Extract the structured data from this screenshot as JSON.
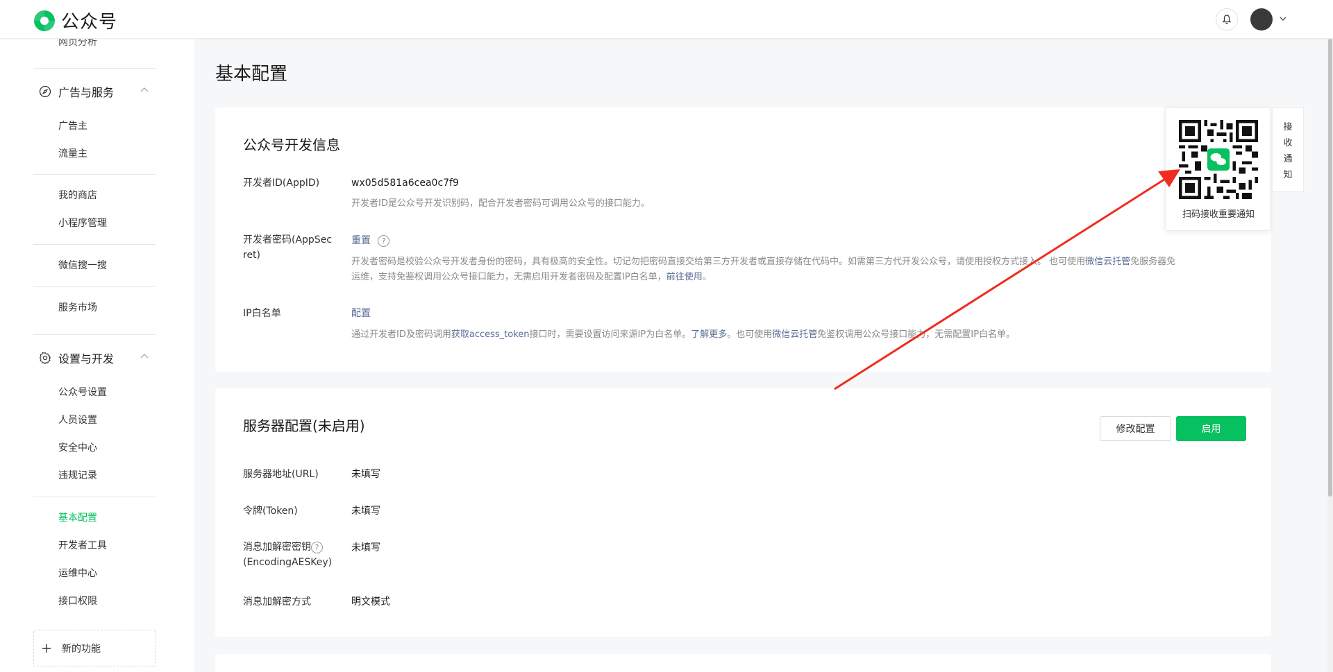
{
  "app": {
    "name": "公众号"
  },
  "header": {
    "bell_icon": "bell-icon",
    "avatar_icon": "avatar",
    "caret_icon": "chevron-down-icon"
  },
  "sidebar": {
    "partial_item": "网页分析",
    "group_ads": {
      "label": "广告与服务",
      "icon": "compass-icon"
    },
    "ads_items": [
      "广告主",
      "流量主"
    ],
    "shop_items": [
      "我的商店",
      "小程序管理"
    ],
    "search_item": "微信搜一搜",
    "market_item": "服务市场",
    "group_settings": {
      "label": "设置与开发",
      "icon": "gear-icon"
    },
    "settings_items": [
      "公众号设置",
      "人员设置",
      "安全中心",
      "违规记录"
    ],
    "dev_items": [
      "基本配置",
      "开发者工具",
      "运维中心",
      "接口权限"
    ],
    "active_item": "基本配置",
    "new_feature": "新的功能"
  },
  "main": {
    "title": "基本配置",
    "dev_info": {
      "title": "公众号开发信息",
      "appid_label": "开发者ID(AppID)",
      "appid_value": "wx05d581a6cea0c7f9",
      "appid_desc": "开发者ID是公众号开发识别码，配合开发者密码可调用公众号的接口能力。",
      "secret_label_1": "开发者密码(AppSec",
      "secret_label_2": "ret)",
      "secret_action": "重置",
      "secret_desc_1": "开发者密码是校验公众号开发者身份的密码，具有极高的安全性。切记勿把密码直接交给第三方开发者或直接存储在代码中。如需第三方代开发公众号，请使用授权方式接入。 也可使用",
      "secret_desc_link_1": "微信云托管",
      "secret_desc_2": "免服务器免",
      "secret_desc_3": "运维，支持免鉴权调用公众号接口能力，无需启用开发者密码及配置IP白名单，",
      "secret_desc_link_2": "前往使用",
      "secret_desc_4": "。",
      "ip_label": "IP白名单",
      "ip_action": "配置",
      "ip_desc_1": "通过开发者ID及密码调用",
      "ip_desc_link_1": "获取access_token",
      "ip_desc_2": "接口时，需要设置访问来源IP为白名单。",
      "ip_desc_link_2": "了解更多",
      "ip_desc_3": "。也可使用",
      "ip_desc_link_3": "微信云托管",
      "ip_desc_4": "免鉴权调用公众号接口能力，无需配置IP白名单。"
    },
    "server": {
      "title": "服务器配置(未启用)",
      "edit_button": "修改配置",
      "enable_button": "启用",
      "url_label": "服务器地址(URL)",
      "url_value": "未填写",
      "token_label": "令牌(Token)",
      "token_value": "未填写",
      "aes_label_1": "消息加解密密钥",
      "aes_label_2": "(EncodingAESKey)",
      "aes_value": "未填写",
      "mode_label": "消息加解密方式",
      "mode_value": "明文模式"
    }
  },
  "qr": {
    "caption": "扫码接收重要通知",
    "tab": [
      "接",
      "收",
      "通",
      "知"
    ]
  },
  "colors": {
    "brand": "#07c160",
    "link": "#576b95",
    "arrow": "#f02b1f"
  }
}
